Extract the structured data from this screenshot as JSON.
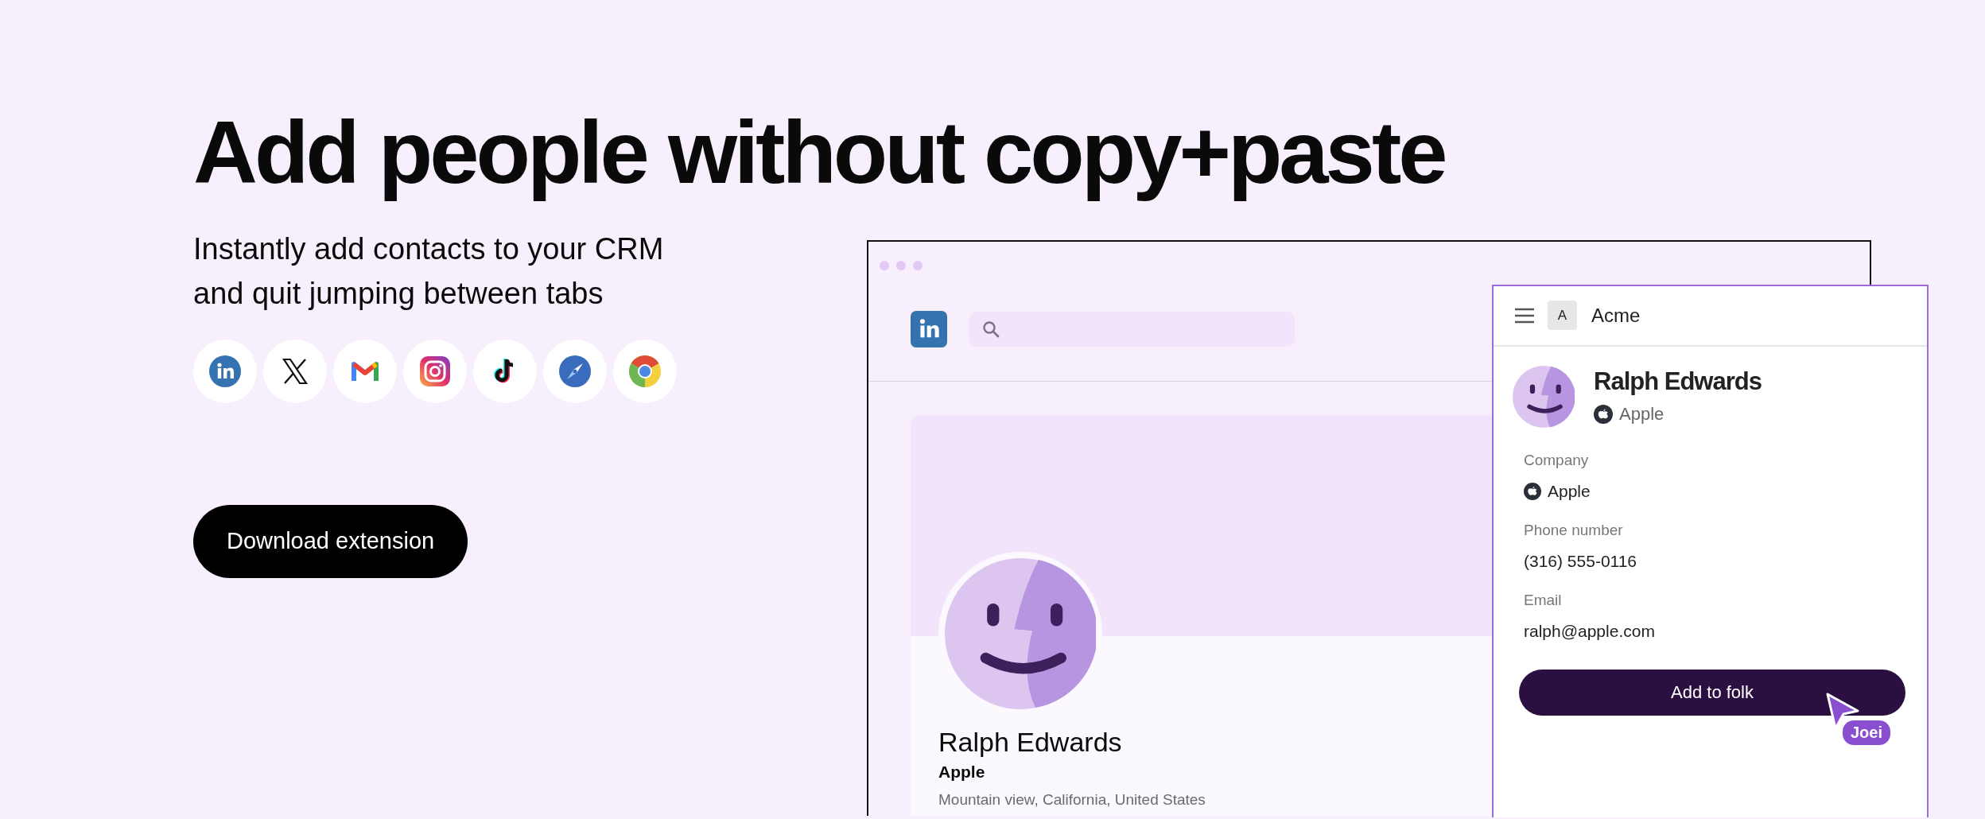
{
  "hero": {
    "title": "Add people without copy+paste",
    "subtitle": "Instantly add contacts to your CRM and quit jumping between tabs",
    "apps": [
      {
        "kind": "linkedin"
      },
      {
        "kind": "x"
      },
      {
        "kind": "gmail"
      },
      {
        "kind": "instagram"
      },
      {
        "kind": "tiktok"
      },
      {
        "kind": "safari"
      },
      {
        "kind": "chrome"
      }
    ],
    "cta": "Download extension"
  },
  "browser": {
    "profile": {
      "name": "Ralph Edwards",
      "company": "Apple",
      "location": "Mountain view, California, United States"
    }
  },
  "extension": {
    "workspace_initial": "A",
    "workspace": "Acme",
    "contact": {
      "name": "Ralph Edwards",
      "company": "Apple"
    },
    "fields": [
      {
        "label": "Company",
        "value": "Apple",
        "kind": "company"
      },
      {
        "label": "Phone number",
        "value": "(316) 555-0116",
        "kind": "text"
      },
      {
        "label": "Email",
        "value": "ralph@apple.com",
        "kind": "text"
      }
    ],
    "button": "Add to folk",
    "cursor_label": "Joei"
  }
}
